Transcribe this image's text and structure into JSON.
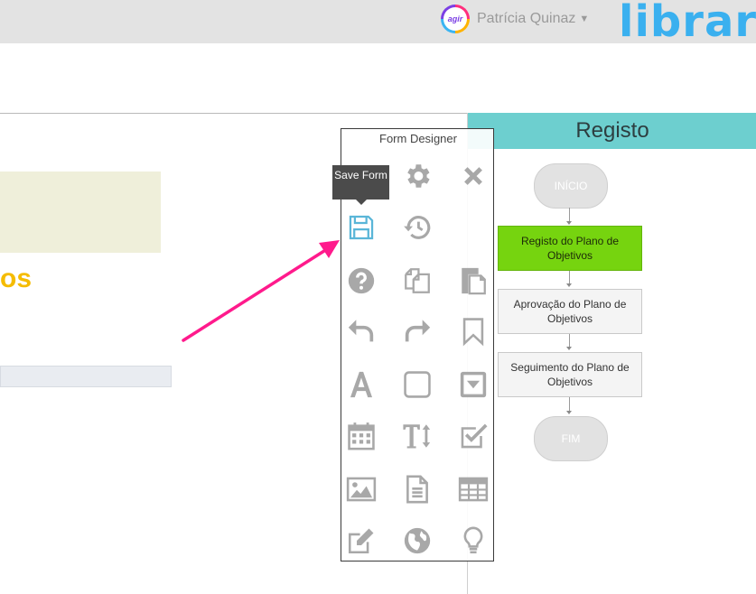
{
  "header": {
    "user_name": "Patrícia Quinaz",
    "avatar_text": "agir",
    "logo": "library"
  },
  "left": {
    "heading_fragment": "os"
  },
  "flow": {
    "title": "Registo",
    "nodes": {
      "start": "INÍCIO",
      "step1": "Registo do Plano de Objetivos",
      "step2": "Aprovação do Plano de Objetivos",
      "step3": "Seguimento do Plano de Objetivos",
      "end": "FIM"
    },
    "active_color": "#76d40f",
    "header_color": "#6dcfcf"
  },
  "designer": {
    "title": "Form Designer",
    "tooltip": "Save Form",
    "icons": [
      "save-icon",
      "gear-icon",
      "close-icon",
      "history-icon",
      "help-icon",
      "copy-icon",
      "paste-icon",
      "undo-icon",
      "redo-icon",
      "bookmark-icon",
      "text-icon",
      "square-icon",
      "dropdown-icon",
      "calendar-icon",
      "text-size-icon",
      "checkbox-icon",
      "image-icon",
      "document-icon",
      "table-icon",
      "edit-icon",
      "globe-icon",
      "lightbulb-icon"
    ]
  },
  "colors": {
    "accent_pink": "#ff1a8c",
    "logo_blue": "#3ab0ef",
    "heading_yellow": "#f5bc00"
  }
}
